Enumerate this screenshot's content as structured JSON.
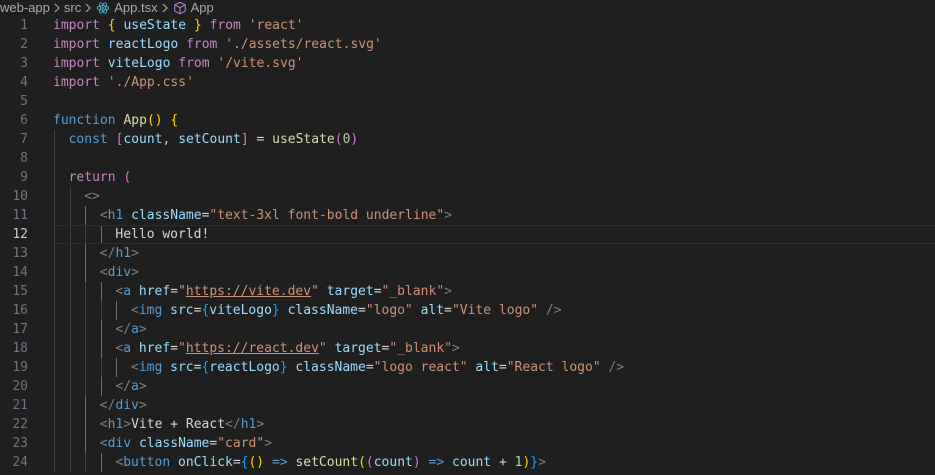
{
  "breadcrumb": {
    "items": [
      "web-app",
      "src",
      "App.tsx",
      "App"
    ]
  },
  "editor": {
    "current_line": 12,
    "lines": [
      {
        "n": "1",
        "indent": 0,
        "tokens": [
          [
            "kw-import",
            "import"
          ],
          [
            "txt",
            " "
          ],
          [
            "br1",
            "{"
          ],
          [
            "txt",
            " "
          ],
          [
            "var",
            "useState"
          ],
          [
            "txt",
            " "
          ],
          [
            "br1",
            "}"
          ],
          [
            "txt",
            " "
          ],
          [
            "kw-import",
            "from"
          ],
          [
            "txt",
            " "
          ],
          [
            "str",
            "'react'"
          ]
        ]
      },
      {
        "n": "2",
        "indent": 0,
        "tokens": [
          [
            "kw-import",
            "import"
          ],
          [
            "txt",
            " "
          ],
          [
            "var",
            "reactLogo"
          ],
          [
            "txt",
            " "
          ],
          [
            "kw-import",
            "from"
          ],
          [
            "txt",
            " "
          ],
          [
            "str",
            "'./assets/react.svg'"
          ]
        ]
      },
      {
        "n": "3",
        "indent": 0,
        "tokens": [
          [
            "kw-import",
            "import"
          ],
          [
            "txt",
            " "
          ],
          [
            "var",
            "viteLogo"
          ],
          [
            "txt",
            " "
          ],
          [
            "kw-import",
            "from"
          ],
          [
            "txt",
            " "
          ],
          [
            "str",
            "'/vite.svg'"
          ]
        ]
      },
      {
        "n": "4",
        "indent": 0,
        "tokens": [
          [
            "kw-import",
            "import"
          ],
          [
            "txt",
            " "
          ],
          [
            "str",
            "'./App.css'"
          ]
        ]
      },
      {
        "n": "5",
        "indent": 0,
        "tokens": []
      },
      {
        "n": "6",
        "indent": 0,
        "tokens": [
          [
            "kw",
            "function"
          ],
          [
            "txt",
            " "
          ],
          [
            "fn",
            "App"
          ],
          [
            "br1",
            "()"
          ],
          [
            "txt",
            " "
          ],
          [
            "br1",
            "{"
          ]
        ]
      },
      {
        "n": "7",
        "indent": 1,
        "tokens": [
          [
            "kw",
            "const"
          ],
          [
            "txt",
            " "
          ],
          [
            "br2",
            "["
          ],
          [
            "var",
            "count"
          ],
          [
            "txt",
            ", "
          ],
          [
            "var",
            "setCount"
          ],
          [
            "br2",
            "]"
          ],
          [
            "txt",
            " = "
          ],
          [
            "fn",
            "useState"
          ],
          [
            "br2",
            "("
          ],
          [
            "num",
            "0"
          ],
          [
            "br2",
            ")"
          ]
        ]
      },
      {
        "n": "8",
        "indent": 1,
        "tokens": []
      },
      {
        "n": "9",
        "indent": 1,
        "tokens": [
          [
            "kw-import",
            "return"
          ],
          [
            "txt",
            " "
          ],
          [
            "br2",
            "("
          ]
        ]
      },
      {
        "n": "10",
        "indent": 2,
        "tokens": [
          [
            "punct-tag",
            "<>"
          ]
        ]
      },
      {
        "n": "11",
        "indent": 3,
        "tokens": [
          [
            "punct-tag",
            "<"
          ],
          [
            "tag",
            "h1"
          ],
          [
            "txt",
            " "
          ],
          [
            "attr",
            "className"
          ],
          [
            "txt",
            "="
          ],
          [
            "str",
            "\"text-3xl font-bold underline\""
          ],
          [
            "punct-tag",
            ">"
          ]
        ]
      },
      {
        "n": "12",
        "indent": 4,
        "tokens": [
          [
            "txt",
            "Hello world!"
          ]
        ]
      },
      {
        "n": "13",
        "indent": 3,
        "tokens": [
          [
            "punct-tag",
            "</"
          ],
          [
            "tag",
            "h1"
          ],
          [
            "punct-tag",
            ">"
          ]
        ]
      },
      {
        "n": "14",
        "indent": 3,
        "tokens": [
          [
            "punct-tag",
            "<"
          ],
          [
            "tag",
            "div"
          ],
          [
            "punct-tag",
            ">"
          ]
        ]
      },
      {
        "n": "15",
        "indent": 4,
        "tokens": [
          [
            "punct-tag",
            "<"
          ],
          [
            "tag",
            "a"
          ],
          [
            "txt",
            " "
          ],
          [
            "attr",
            "href"
          ],
          [
            "txt",
            "="
          ],
          [
            "str",
            "\""
          ],
          [
            "str url",
            "https://vite.dev"
          ],
          [
            "str",
            "\""
          ],
          [
            "txt",
            " "
          ],
          [
            "attr",
            "target"
          ],
          [
            "txt",
            "="
          ],
          [
            "str",
            "\"_blank\""
          ],
          [
            "punct-tag",
            ">"
          ]
        ]
      },
      {
        "n": "16",
        "indent": 5,
        "tokens": [
          [
            "punct-tag",
            "<"
          ],
          [
            "tag",
            "img"
          ],
          [
            "txt",
            " "
          ],
          [
            "attr",
            "src"
          ],
          [
            "txt",
            "="
          ],
          [
            "br3",
            "{"
          ],
          [
            "var",
            "viteLogo"
          ],
          [
            "br3",
            "}"
          ],
          [
            "txt",
            " "
          ],
          [
            "attr",
            "className"
          ],
          [
            "txt",
            "="
          ],
          [
            "str",
            "\"logo\""
          ],
          [
            "txt",
            " "
          ],
          [
            "attr",
            "alt"
          ],
          [
            "txt",
            "="
          ],
          [
            "str",
            "\"Vite logo\""
          ],
          [
            "txt",
            " "
          ],
          [
            "punct-tag",
            "/>"
          ]
        ]
      },
      {
        "n": "17",
        "indent": 4,
        "tokens": [
          [
            "punct-tag",
            "</"
          ],
          [
            "tag",
            "a"
          ],
          [
            "punct-tag",
            ">"
          ]
        ]
      },
      {
        "n": "18",
        "indent": 4,
        "tokens": [
          [
            "punct-tag",
            "<"
          ],
          [
            "tag",
            "a"
          ],
          [
            "txt",
            " "
          ],
          [
            "attr",
            "href"
          ],
          [
            "txt",
            "="
          ],
          [
            "str",
            "\""
          ],
          [
            "str url",
            "https://react.dev"
          ],
          [
            "str",
            "\""
          ],
          [
            "txt",
            " "
          ],
          [
            "attr",
            "target"
          ],
          [
            "txt",
            "="
          ],
          [
            "str",
            "\"_blank\""
          ],
          [
            "punct-tag",
            ">"
          ]
        ]
      },
      {
        "n": "19",
        "indent": 5,
        "tokens": [
          [
            "punct-tag",
            "<"
          ],
          [
            "tag",
            "img"
          ],
          [
            "txt",
            " "
          ],
          [
            "attr",
            "src"
          ],
          [
            "txt",
            "="
          ],
          [
            "br3",
            "{"
          ],
          [
            "var",
            "reactLogo"
          ],
          [
            "br3",
            "}"
          ],
          [
            "txt",
            " "
          ],
          [
            "attr",
            "className"
          ],
          [
            "txt",
            "="
          ],
          [
            "str",
            "\"logo react\""
          ],
          [
            "txt",
            " "
          ],
          [
            "attr",
            "alt"
          ],
          [
            "txt",
            "="
          ],
          [
            "str",
            "\"React logo\""
          ],
          [
            "txt",
            " "
          ],
          [
            "punct-tag",
            "/>"
          ]
        ]
      },
      {
        "n": "20",
        "indent": 4,
        "tokens": [
          [
            "punct-tag",
            "</"
          ],
          [
            "tag",
            "a"
          ],
          [
            "punct-tag",
            ">"
          ]
        ]
      },
      {
        "n": "21",
        "indent": 3,
        "tokens": [
          [
            "punct-tag",
            "</"
          ],
          [
            "tag",
            "div"
          ],
          [
            "punct-tag",
            ">"
          ]
        ]
      },
      {
        "n": "22",
        "indent": 3,
        "tokens": [
          [
            "punct-tag",
            "<"
          ],
          [
            "tag",
            "h1"
          ],
          [
            "punct-tag",
            ">"
          ],
          [
            "txt",
            "Vite + React"
          ],
          [
            "punct-tag",
            "</"
          ],
          [
            "tag",
            "h1"
          ],
          [
            "punct-tag",
            ">"
          ]
        ]
      },
      {
        "n": "23",
        "indent": 3,
        "tokens": [
          [
            "punct-tag",
            "<"
          ],
          [
            "tag",
            "div"
          ],
          [
            "txt",
            " "
          ],
          [
            "attr",
            "className"
          ],
          [
            "txt",
            "="
          ],
          [
            "str",
            "\"card\""
          ],
          [
            "punct-tag",
            ">"
          ]
        ]
      },
      {
        "n": "24",
        "indent": 4,
        "tokens": [
          [
            "punct-tag",
            "<"
          ],
          [
            "tag",
            "button"
          ],
          [
            "txt",
            " "
          ],
          [
            "attr",
            "onClick"
          ],
          [
            "txt",
            "="
          ],
          [
            "br3",
            "{"
          ],
          [
            "br1",
            "()"
          ],
          [
            "txt",
            " "
          ],
          [
            "kw",
            "=>"
          ],
          [
            "txt",
            " "
          ],
          [
            "fn",
            "setCount"
          ],
          [
            "br1",
            "("
          ],
          [
            "br2",
            "("
          ],
          [
            "var",
            "count"
          ],
          [
            "br2",
            ")"
          ],
          [
            "txt",
            " "
          ],
          [
            "kw",
            "=>"
          ],
          [
            "txt",
            " "
          ],
          [
            "var",
            "count"
          ],
          [
            "txt",
            " + "
          ],
          [
            "num",
            "1"
          ],
          [
            "br1",
            ")"
          ],
          [
            "br3",
            "}"
          ],
          [
            "punct-tag",
            ">"
          ]
        ]
      }
    ]
  }
}
